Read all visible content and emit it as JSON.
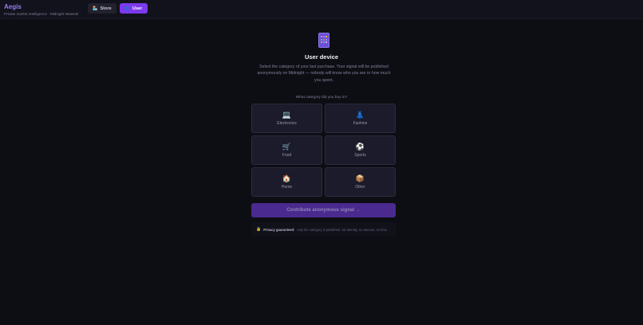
{
  "header": {
    "brand_title": "Aegis",
    "brand_subtitle": "Private market intelligence · Midnight Network",
    "nav": {
      "store": {
        "label": "Store",
        "icon": "store-icon"
      },
      "user": {
        "label": "User",
        "icon": "user-icon",
        "active": true
      }
    }
  },
  "main": {
    "hero_icon": "mobile-phone-icon",
    "title": "User device",
    "description": "Select the category of your last purchase. Your signal will be published anonymously on Midnight — nobody will know who you are or how much you spent.",
    "question": "What category did you buy in?",
    "categories": [
      {
        "label": "Electronics",
        "icon": "laptop-icon",
        "glyph": "💻"
      },
      {
        "label": "Fashion",
        "icon": "dress-icon",
        "glyph": "👗"
      },
      {
        "label": "Food",
        "icon": "cart-icon",
        "glyph": "🛒"
      },
      {
        "label": "Sports",
        "icon": "ball-icon",
        "glyph": "⚽"
      },
      {
        "label": "Home",
        "icon": "house-icon",
        "glyph": "🏠"
      },
      {
        "label": "Other",
        "icon": "package-icon",
        "glyph": "📦"
      }
    ],
    "cta_label": "Contribute anonymous signal →",
    "privacy": {
      "icon": "lock-icon",
      "strong": "Privacy guaranteed:",
      "text": "only the category is published. No identity, no amount, no time."
    }
  },
  "colors": {
    "background": "#0d0d14",
    "accent": "#7c3aed",
    "brand": "#9a7cf0",
    "card": "#1b1b2b"
  }
}
